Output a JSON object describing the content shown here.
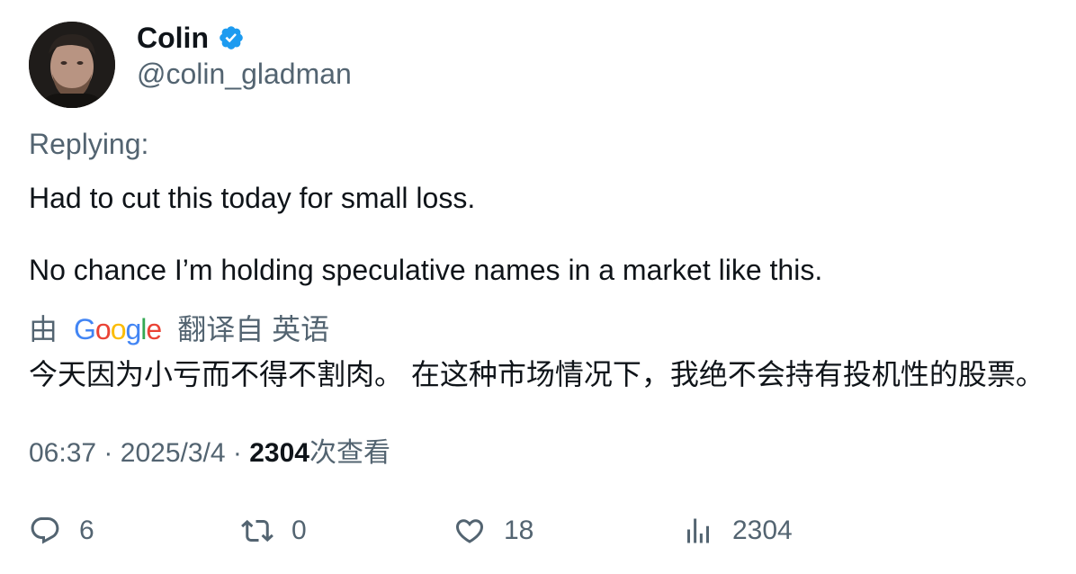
{
  "author": {
    "name": "Colin",
    "handle": "@colin_gladman",
    "verified_color": "#1d9bf0"
  },
  "replying_label": "Replying:",
  "tweet": {
    "line1": "Had to cut this today for small loss.",
    "line2": "No chance I’m holding speculative names in a market like this."
  },
  "translation": {
    "prefix": "由",
    "provider_letters": [
      "G",
      "o",
      "o",
      "g",
      "l",
      "e"
    ],
    "suffix": "翻译自 英语",
    "text": "今天因为小亏而不得不割肉。 在这种市场情况下，我绝不会持有投机性的股票。"
  },
  "meta": {
    "time": "06:37",
    "separator": "·",
    "date": "2025/3/4",
    "views_count": "2304",
    "views_label": "次查看"
  },
  "actions": {
    "replies": "6",
    "retweets": "0",
    "likes": "18",
    "views": "2304"
  },
  "icons": {
    "reply": "reply-icon",
    "retweet": "retweet-icon",
    "like": "heart-icon",
    "views": "views-chart-icon",
    "verified": "verified-badge-icon"
  }
}
